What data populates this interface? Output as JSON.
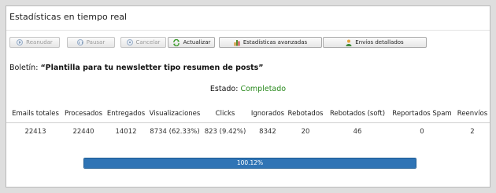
{
  "window": {
    "title": "Estadísticas en tiempo real"
  },
  "toolbar": {
    "buttons": [
      {
        "label": "Reanudar",
        "icon": "resume-icon",
        "disabled": true
      },
      {
        "label": "Pausar",
        "icon": "pause-icon",
        "disabled": true
      },
      {
        "label": "Cancelar",
        "icon": "cancel-icon",
        "disabled": true
      },
      {
        "label": "Actualizar",
        "icon": "refresh-icon",
        "disabled": false
      },
      {
        "label": "Estadísticas avanzadas",
        "icon": "chart-icon",
        "disabled": false
      },
      {
        "label": "Envíos detallados",
        "icon": "user-icon",
        "disabled": false
      }
    ]
  },
  "bulletin": {
    "label": "Boletín:",
    "name": "“Plantilla para tu newsletter tipo resumen de posts”"
  },
  "status": {
    "label": "Estado:",
    "value": "Completado",
    "value_color": "#2a8a1e"
  },
  "stats": {
    "headers": [
      "Emails totales",
      "Procesados",
      "Entregados",
      "Visualizaciones",
      "Clicks",
      "Ignorados",
      "Rebotados",
      "Rebotados (soft)",
      "Reportados Spam",
      "Reenvíos"
    ],
    "values": [
      "22413",
      "22440",
      "14012",
      "8734 (62.33%)",
      "823 (9.42%)",
      "8342",
      "20",
      "46",
      "0",
      "2"
    ]
  },
  "progress": {
    "text": "100.12%",
    "fraction": 1.0,
    "fill_color": "#2f74b5"
  }
}
